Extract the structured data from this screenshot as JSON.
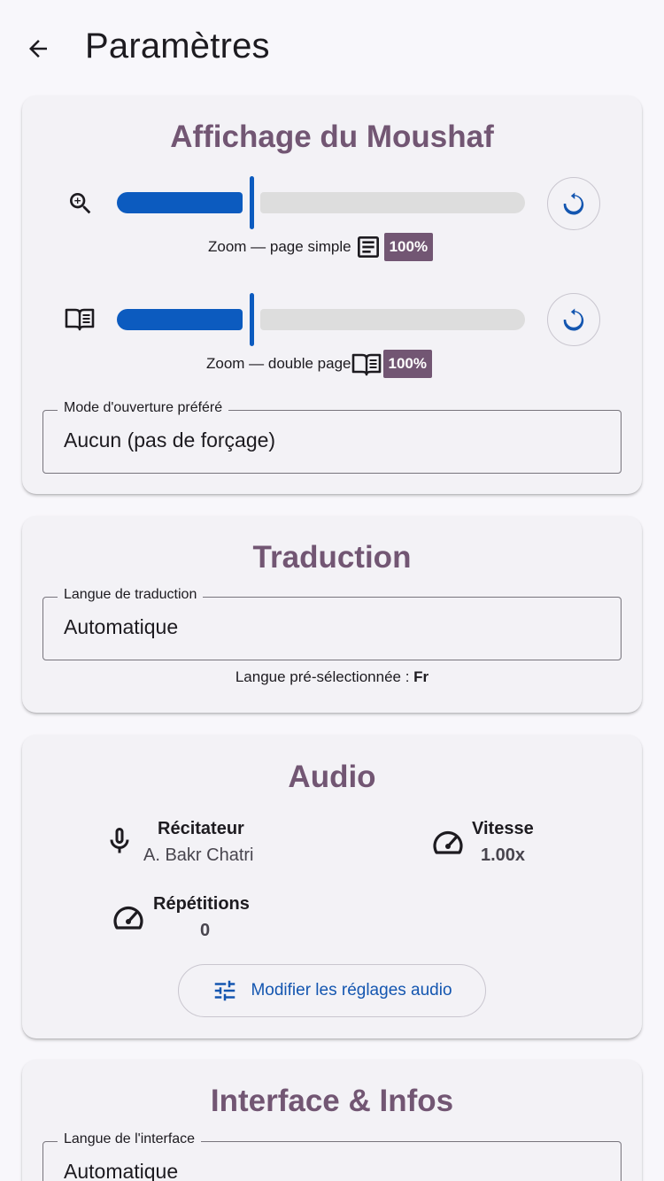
{
  "appbar": {
    "title": "Paramètres"
  },
  "moushaf": {
    "title": "Affichage du Moushaf",
    "single": {
      "caption": "Zoom — page simple",
      "value_label": "100%",
      "fraction": 0.33
    },
    "double": {
      "caption": "Zoom — double page",
      "value_label": "100%",
      "fraction": 0.33
    },
    "open_mode": {
      "label": "Mode d'ouverture préféré",
      "value": "Aucun (pas de forçage)"
    }
  },
  "translation": {
    "title": "Traduction",
    "field": {
      "label": "Langue de traduction",
      "value": "Automatique"
    },
    "helper_prefix": "Langue pré-sélectionnée : ",
    "helper_value": "Fr"
  },
  "audio": {
    "title": "Audio",
    "reciter": {
      "label": "Récitateur",
      "value": "A. Bakr Chatri"
    },
    "speed": {
      "label": "Vitesse",
      "value": "1.00x"
    },
    "repetitions": {
      "label": "Répétitions",
      "value": "0"
    },
    "button_label": "Modifier les réglages audio"
  },
  "interface": {
    "title": "Interface & Infos",
    "field": {
      "label": "Langue de l'interface",
      "value": "Automatique"
    }
  },
  "colors": {
    "accent": "#725673",
    "slider": "#0c5bbf",
    "link": "#1456b0",
    "background": "#f8f7fb",
    "card": "#f3f2f6"
  }
}
